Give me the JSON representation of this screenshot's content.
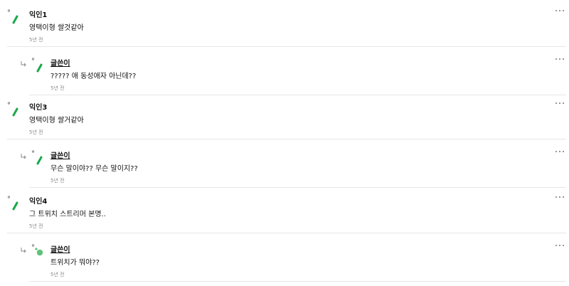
{
  "comments": [
    {
      "kind": "top",
      "author": "익인1",
      "body": "영택이형 쌀것같아",
      "time": "5년 전",
      "avatar": "green-slash"
    },
    {
      "kind": "reply",
      "author": "글쓴이",
      "body": "????? 애 동성애자 아닌데??",
      "time": "5년 전",
      "avatar": "green-slash"
    },
    {
      "kind": "top",
      "author": "익인3",
      "body": "영택이형 쌀거같아",
      "time": "5년 전",
      "avatar": "green-slash"
    },
    {
      "kind": "reply",
      "author": "글쓴이",
      "body": "무슨 말이야?? 무슨 말이지??",
      "time": "5년 전",
      "avatar": "green-slash"
    },
    {
      "kind": "top",
      "author": "익인4",
      "body": "그 트위치 스트리머 본명..",
      "time": "5년 전",
      "avatar": "green-slash"
    },
    {
      "kind": "reply",
      "author": "글쓴이",
      "body": "트위치가 뭐야??",
      "time": "5년 전",
      "avatar": "green-dots"
    }
  ],
  "colors": {
    "accent": "#1aa84a",
    "accent_light": "#5fc27a",
    "separator": "#e6e6e6",
    "meta": "#8a8a8a"
  },
  "icons": {
    "more": "more-dots-icon",
    "reply": "reply-arrow-icon"
  }
}
